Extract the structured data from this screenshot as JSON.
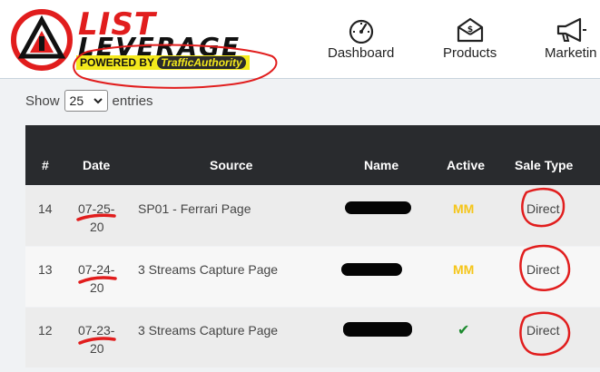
{
  "header": {
    "logo": {
      "line1": "LIST",
      "line2": "LEVERAGE",
      "powered_prefix": "POWERED BY",
      "powered_brand": "TrafficAuthority"
    },
    "nav": [
      {
        "label": "Dashboard",
        "icon": "gauge-icon"
      },
      {
        "label": "Products",
        "icon": "money-box-icon"
      },
      {
        "label": "Marketin",
        "icon": "megaphone-icon"
      }
    ]
  },
  "controls": {
    "show_label": "Show",
    "entries_value": "25",
    "entries_label": "entries"
  },
  "table": {
    "columns": [
      "#",
      "Date",
      "Source",
      "Name",
      "Active",
      "Sale Type"
    ],
    "rows": [
      {
        "num": "14",
        "date_line1": "07-25-",
        "date_line2": "20",
        "source": "SP01 - Ferrari Page",
        "active": "MM",
        "sale_type": "Direct"
      },
      {
        "num": "13",
        "date_line1": "07-24-",
        "date_line2": "20",
        "source": "3 Streams Capture Page",
        "active": "MM",
        "sale_type": "Direct"
      },
      {
        "num": "12",
        "date_line1": "07-23-",
        "date_line2": "20",
        "source": "3 Streams Capture Page",
        "active": "✔",
        "sale_type": "Direct"
      }
    ]
  },
  "colors": {
    "accent_red": "#e11d1d",
    "header_dark": "#292b2e",
    "mm_yellow": "#f5c518",
    "check_green": "#1c8a2e",
    "powered_yellow": "#f4e91c"
  }
}
